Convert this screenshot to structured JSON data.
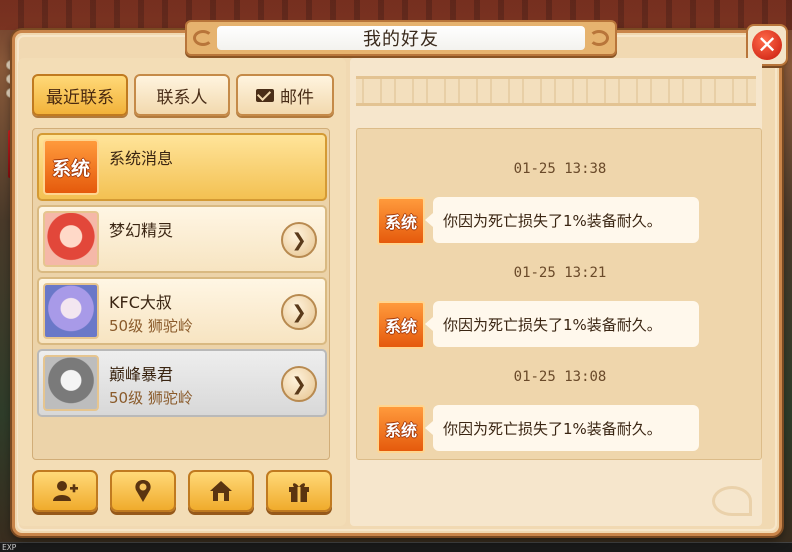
{
  "dialog": {
    "title": "我的好友",
    "close_label": "✕"
  },
  "tabs": [
    {
      "label": "最近联系",
      "active": true
    },
    {
      "label": "联系人",
      "active": false
    },
    {
      "label": "邮件",
      "active": false,
      "icon": "mail-icon"
    }
  ],
  "contacts": [
    {
      "avatar_text": "系统",
      "name": "系统消息",
      "sub": "",
      "state": "selected"
    },
    {
      "avatar_icon": "pink-hair-character-avatar",
      "name": "梦幻精灵",
      "sub": "",
      "state": "normal"
    },
    {
      "avatar_icon": "white-hair-character-avatar",
      "name": "KFC大叔",
      "sub": "50级 狮驼岭",
      "state": "normal"
    },
    {
      "avatar_icon": "grayscale-character-avatar",
      "name": "巅峰暴君",
      "sub": "50级 狮驼岭",
      "state": "offline"
    }
  ],
  "arrow_glyph": "❯",
  "bottom_buttons": [
    {
      "icon": "add-friend-icon"
    },
    {
      "icon": "location-pin-icon"
    },
    {
      "icon": "home-icon"
    },
    {
      "icon": "gift-icon"
    }
  ],
  "messages": [
    {
      "time": "01-25 13:38",
      "sender_icon_text": "系统",
      "text": "你因为死亡损失了1%装备耐久。"
    },
    {
      "time": "01-25 13:21",
      "sender_icon_text": "系统",
      "text": "你因为死亡损失了1%装备耐久。"
    },
    {
      "time": "01-25 13:08",
      "sender_icon_text": "系统",
      "text": "你因为死亡损失了1%装备耐久。"
    }
  ],
  "hud": {
    "exp_label": "EXP"
  },
  "colors": {
    "accent_orange": "#f0ab2c",
    "system_badge": "#e55a0c",
    "close_red": "#c7190b"
  }
}
